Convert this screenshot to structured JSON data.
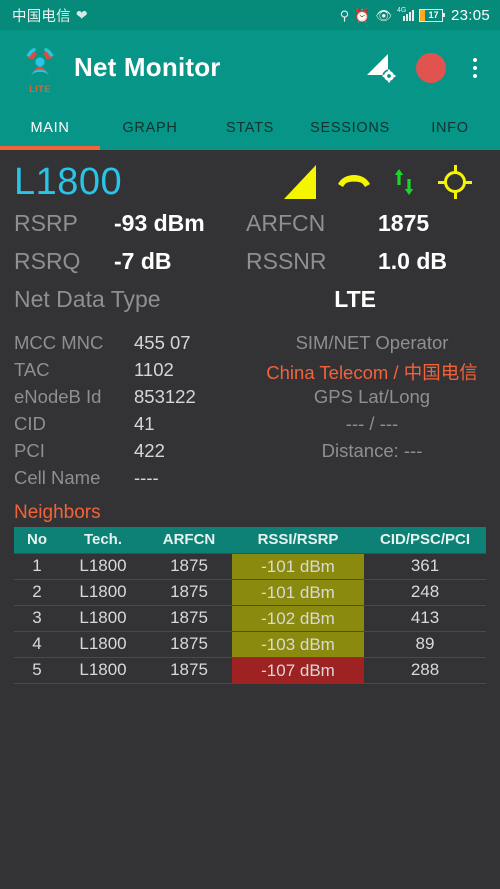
{
  "statusbar": {
    "carrier": "中国电信",
    "heart_icon": "heart-icon",
    "icons": [
      "location-pin-icon",
      "alarm-clock-icon",
      "eye-icon",
      "signal-4g-icon",
      "battery-icon"
    ],
    "network_gen": "4G",
    "battery_level": "17",
    "time": "23:05"
  },
  "appbar": {
    "logo_label": "LITE",
    "title": "Net Monitor",
    "signal_settings_icon": "signal-settings-icon",
    "record_icon": "record-circle-icon",
    "overflow_icon": "overflow-menu-icon"
  },
  "tabs": {
    "items": [
      {
        "label": "MAIN",
        "active": true
      },
      {
        "label": "GRAPH",
        "active": false
      },
      {
        "label": "STATS",
        "active": false
      },
      {
        "label": "SESSIONS",
        "active": false
      },
      {
        "label": "INFO",
        "active": false
      }
    ]
  },
  "band": {
    "name": "L1800",
    "icons": [
      "signal-triangle-icon",
      "phone-hangup-icon",
      "data-updown-icon",
      "gps-crosshair-icon"
    ]
  },
  "metrics": {
    "rsrp_label": "RSRP",
    "rsrp_value": "-93 dBm",
    "arfcn_label": "ARFCN",
    "arfcn_value": "1875",
    "rsrq_label": "RSRQ",
    "rsrq_value": "-7 dB",
    "rssnr_label": "RSSNR",
    "rssnr_value": "1.0 dB",
    "net_data_type_label": "Net Data Type",
    "net_data_type_value": "LTE"
  },
  "cellinfo": {
    "rows": [
      {
        "label": "MCC MNC",
        "value": "455 07"
      },
      {
        "label": "TAC",
        "value": "1102"
      },
      {
        "label": "eNodeB Id",
        "value": "853122"
      },
      {
        "label": "CID",
        "value": "41"
      },
      {
        "label": "PCI",
        "value": "422"
      },
      {
        "label": "Cell Name",
        "value": "----"
      }
    ],
    "operator_label": "SIM/NET Operator",
    "operator_value": "China Telecom / 中国电信",
    "gps_label": "GPS Lat/Long",
    "gps_value": "--- / ---",
    "distance": "Distance: ---"
  },
  "neighbors": {
    "title": "Neighbors",
    "columns": [
      "No",
      "Tech.",
      "ARFCN",
      "RSSI/RSRP",
      "CID/PSC/PCI"
    ],
    "rows": [
      {
        "no": "1",
        "tech": "L1800",
        "arfcn": "1875",
        "rssi": "-101 dBm",
        "rssi_color": "#8a8a0e",
        "cid": "361"
      },
      {
        "no": "2",
        "tech": "L1800",
        "arfcn": "1875",
        "rssi": "-101 dBm",
        "rssi_color": "#8a8a0e",
        "cid": "248"
      },
      {
        "no": "3",
        "tech": "L1800",
        "arfcn": "1875",
        "rssi": "-102 dBm",
        "rssi_color": "#8a8a0e",
        "cid": "413"
      },
      {
        "no": "4",
        "tech": "L1800",
        "arfcn": "1875",
        "rssi": "-103 dBm",
        "rssi_color": "#8a8a0e",
        "cid": "89"
      },
      {
        "no": "5",
        "tech": "L1800",
        "arfcn": "1875",
        "rssi": "-107 dBm",
        "rssi_color": "#9e2222",
        "cid": "288"
      }
    ]
  },
  "colors": {
    "teal": "#069587",
    "teal_dark": "#068a7a",
    "accent_orange": "#f4623a",
    "cyan": "#29c5e8",
    "background": "#333336",
    "yellow": "#f5f500",
    "green": "#1ad62c",
    "record_red": "#e0534f"
  }
}
